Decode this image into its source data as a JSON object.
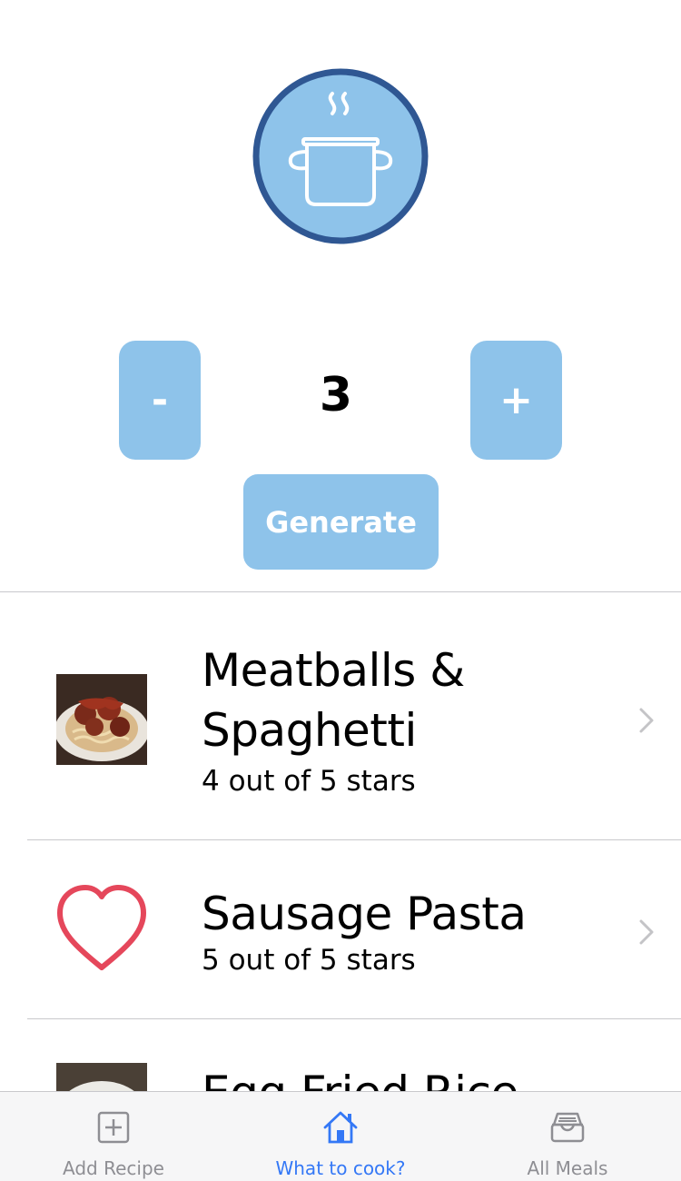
{
  "stepper": {
    "minus_label": "-",
    "plus_label": "+",
    "count": "3"
  },
  "generate_label": "Generate",
  "recipes": [
    {
      "title": "Meatballs & Spaghetti",
      "rating": "4 out of 5 stars",
      "image": "meatballs-photo"
    },
    {
      "title": "Sausage Pasta",
      "rating": "5 out of 5 stars",
      "image": "heart-icon"
    },
    {
      "title": "Egg Fried Rice",
      "rating": "",
      "image": "fried-rice-photo"
    }
  ],
  "tabs": [
    {
      "label": "Add Recipe",
      "icon": "plus-square-icon",
      "active": false
    },
    {
      "label": "What to cook?",
      "icon": "home-icon",
      "active": true
    },
    {
      "label": "All Meals",
      "icon": "tray-icon",
      "active": false
    }
  ],
  "colors": {
    "accent": "#8ec3ea",
    "logo_ring": "#2f5793",
    "tab_active": "#3478f6",
    "heart": "#e5475b"
  }
}
